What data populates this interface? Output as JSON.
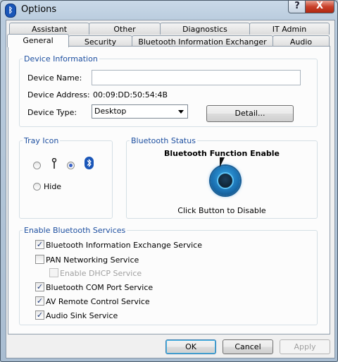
{
  "window": {
    "title": "Options"
  },
  "tabs_row1": [
    "Assistant",
    "Other",
    "Diagnostics",
    "IT Admin"
  ],
  "tabs_row2": [
    "General",
    "Security",
    "Bluetooth Information Exchanger",
    "Audio"
  ],
  "active_tab": "General",
  "device_info": {
    "legend": "Device Information",
    "name_label": "Device Name:",
    "name_value": "",
    "address_label": "Device Address:",
    "address_value": "00:09:DD:50:54:4B",
    "type_label": "Device Type:",
    "type_value": "Desktop",
    "detail_button": "Detail..."
  },
  "tray_icon": {
    "legend": "Tray Icon",
    "hide_label": "Hide",
    "selected": "bluetooth"
  },
  "bluetooth_status": {
    "legend": "Bluetooth Status",
    "status_text": "Bluetooth Function Enable",
    "hint_text": "Click Button to Disable"
  },
  "services": {
    "legend": "Enable Bluetooth Services",
    "items": [
      {
        "label": "Bluetooth Information Exchange Service",
        "checked": true,
        "enabled": true
      },
      {
        "label": "PAN Networking Service",
        "checked": false,
        "enabled": true
      },
      {
        "label": "Enable DHCP Service",
        "checked": false,
        "enabled": false
      },
      {
        "label": "Bluetooth COM Port Service",
        "checked": true,
        "enabled": true
      },
      {
        "label": "AV Remote Control Service",
        "checked": true,
        "enabled": true
      },
      {
        "label": "Audio Sink Service",
        "checked": true,
        "enabled": true
      }
    ]
  },
  "buttons": {
    "ok": "OK",
    "cancel": "Cancel",
    "apply": "Apply"
  },
  "titlebar": {
    "help_glyph": "?",
    "close_glyph": "X"
  }
}
